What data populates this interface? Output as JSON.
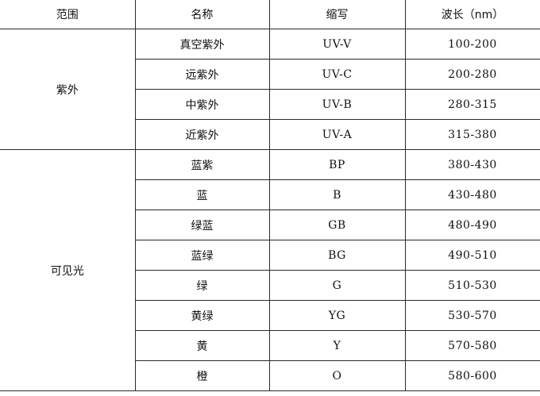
{
  "table": {
    "headers": {
      "range": "范围",
      "name": "名称",
      "abbr": "缩写",
      "wavelength": "波长（nm）"
    },
    "groups": {
      "uv": {
        "label": "紫外",
        "rows": [
          {
            "name": "真空紫外",
            "abbr": "UV-V",
            "wavelength": "100-200"
          },
          {
            "name": "远紫外",
            "abbr": "UV-C",
            "wavelength": "200-280"
          },
          {
            "name": "中紫外",
            "abbr": "UV-B",
            "wavelength": "280-315"
          },
          {
            "name": "近紫外",
            "abbr": "UV-A",
            "wavelength": "315-380"
          }
        ]
      },
      "visible": {
        "label": "可见光",
        "rows": [
          {
            "name": "蓝紫",
            "abbr": "BP",
            "wavelength": "380-430"
          },
          {
            "name": "蓝",
            "abbr": "B",
            "wavelength": "430-480"
          },
          {
            "name": "绿蓝",
            "abbr": "GB",
            "wavelength": "480-490"
          },
          {
            "name": "蓝绿",
            "abbr": "BG",
            "wavelength": "490-510"
          },
          {
            "name": "绿",
            "abbr": "G",
            "wavelength": "510-530"
          },
          {
            "name": "黄绿",
            "abbr": "YG",
            "wavelength": "530-570"
          },
          {
            "name": "黄",
            "abbr": "Y",
            "wavelength": "570-580"
          },
          {
            "name": "橙",
            "abbr": "O",
            "wavelength": "580-600"
          }
        ]
      }
    }
  }
}
